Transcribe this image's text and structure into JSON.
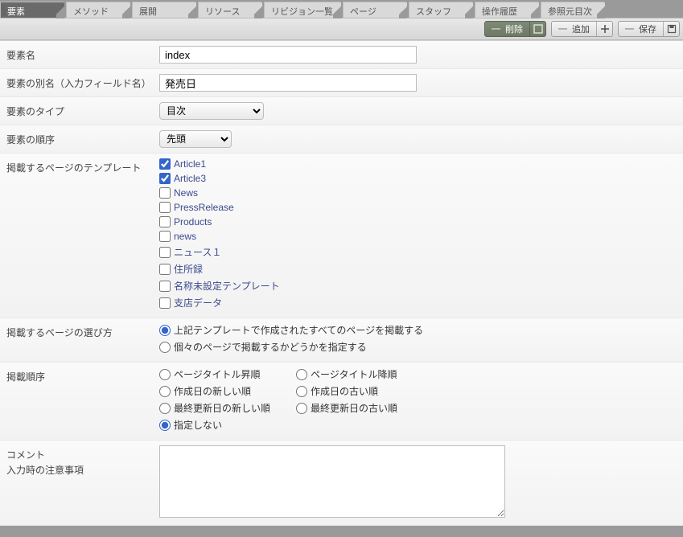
{
  "tabs": {
    "items": [
      "要素",
      "メソッド",
      "展開",
      "リソース",
      "リビジョン一覧",
      "ページ",
      "スタッフ",
      "操作履歴",
      "参照元目次"
    ],
    "active_index": 0
  },
  "actions": {
    "delete": "削除",
    "add": "追加",
    "save": "保存"
  },
  "rows": {
    "name_label": "要素名",
    "name_value": "index",
    "alias_label": "要素の別名（入力フィールド名）",
    "alias_value": "発売日",
    "type_label": "要素のタイプ",
    "type_value": "目次",
    "order_label": "要素の順序",
    "order_value": "先頭",
    "templates_label": "掲載するページのテンプレート",
    "templates": [
      {
        "label": "Article1",
        "checked": true
      },
      {
        "label": "Article3",
        "checked": true
      },
      {
        "label": "News",
        "checked": false
      },
      {
        "label": "PressRelease",
        "checked": false
      },
      {
        "label": "Products",
        "checked": false
      },
      {
        "label": "news",
        "checked": false
      },
      {
        "label": "ニュース１",
        "checked": false
      },
      {
        "label": "住所録",
        "checked": false
      },
      {
        "label": "名称未設定テンプレート",
        "checked": false
      },
      {
        "label": "支店データ",
        "checked": false
      }
    ],
    "selection_label": "掲載するページの選び方",
    "selection_options": [
      {
        "label": "上記テンプレートで作成されたすべてのページを掲載する",
        "checked": true
      },
      {
        "label": "個々のページで掲載するかどうかを指定する",
        "checked": false
      }
    ],
    "sort_label": "掲載順序",
    "sort_options": [
      {
        "label": "ページタイトル昇順",
        "checked": false
      },
      {
        "label": "ページタイトル降順",
        "checked": false
      },
      {
        "label": "作成日の新しい順",
        "checked": false
      },
      {
        "label": "作成日の古い順",
        "checked": false
      },
      {
        "label": "最終更新日の新しい順",
        "checked": false
      },
      {
        "label": "最終更新日の古い順",
        "checked": false
      },
      {
        "label": "指定しない",
        "checked": true
      }
    ],
    "comment_label_1": "コメント",
    "comment_label_2": "入力時の注意事項",
    "comment_value": ""
  }
}
